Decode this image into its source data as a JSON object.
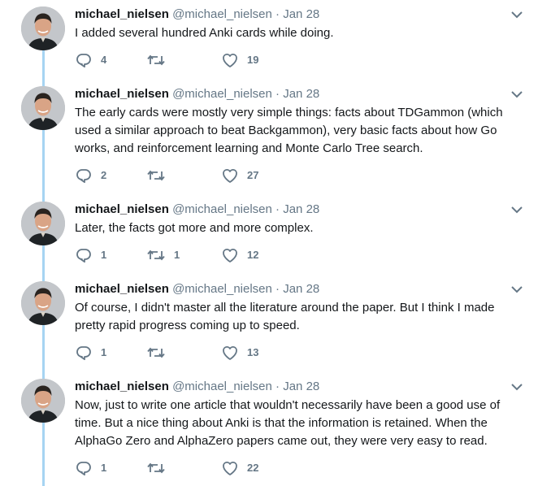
{
  "tweets": [
    {
      "name": "michael_nielsen",
      "handle": "@michael_nielsen",
      "sep": "·",
      "date": "Jan 28",
      "text": "I added several hundred Anki cards while doing.",
      "replies": "4",
      "retweets": "",
      "likes": "19"
    },
    {
      "name": "michael_nielsen",
      "handle": "@michael_nielsen",
      "sep": "·",
      "date": "Jan 28",
      "text": "The early cards were mostly very simple things: facts about TDGammon (which used a similar approach to beat Backgammon), very basic facts about how Go works, and reinforcement learning and Monte Carlo Tree search.",
      "replies": "2",
      "retweets": "",
      "likes": "27"
    },
    {
      "name": "michael_nielsen",
      "handle": "@michael_nielsen",
      "sep": "·",
      "date": "Jan 28",
      "text": "Later, the facts got more and more complex.",
      "replies": "1",
      "retweets": "1",
      "likes": "12"
    },
    {
      "name": "michael_nielsen",
      "handle": "@michael_nielsen",
      "sep": "·",
      "date": "Jan 28",
      "text": "Of course, I didn't master all the literature around the paper. But I think I made pretty rapid progress coming up to speed.",
      "replies": "1",
      "retweets": "",
      "likes": "13"
    },
    {
      "name": "michael_nielsen",
      "handle": "@michael_nielsen",
      "sep": "·",
      "date": "Jan 28",
      "text": "Now, just to write one article that wouldn't necessarily have been a good use of time. But a nice thing about Anki is that the information is retained. When the AlphaGo Zero and AlphaZero papers came out, they were very easy to read.",
      "replies": "1",
      "retweets": "",
      "likes": "22"
    }
  ],
  "colors": {
    "thread_line": "#a6d4f2",
    "secondary_text": "#657786",
    "primary_text": "#14171a"
  },
  "icons": {
    "reply": "reply-icon",
    "retweet": "retweet-icon",
    "like": "heart-icon",
    "more": "chevron-down-icon",
    "avatar": "avatar"
  }
}
